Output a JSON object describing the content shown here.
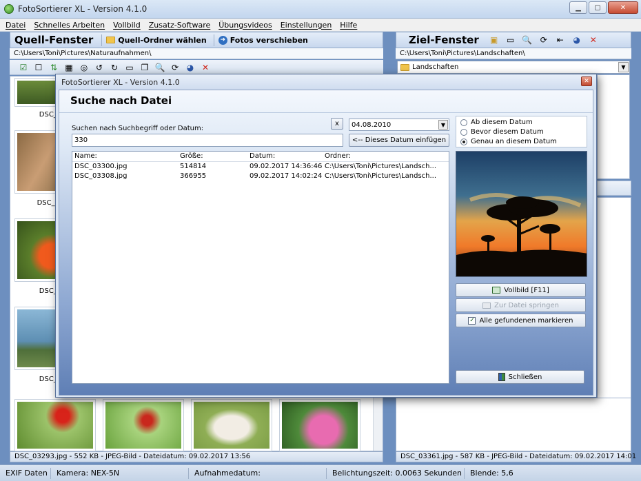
{
  "app": {
    "title": "FotoSortierer XL - Version 4.1.0",
    "accent": "#c8d8ee"
  },
  "menu": [
    "Datei",
    "Schnelles Arbeiten",
    "Vollbild",
    "Zusatz-Software",
    "Übungsvideos",
    "Einstellungen",
    "Hilfe"
  ],
  "left": {
    "title": "Quell-Fenster",
    "choose_folder": "Quell-Ordner wählen",
    "move_photos": "Fotos verschieben",
    "path": "C:\\Users\\Toni\\Pictures\\Naturaufnahmen\\",
    "thumb_labels": [
      "DSC_0",
      "DSC_03",
      "DSC_0",
      "DSC_0"
    ],
    "status": "DSC_03293.jpg - 552 KB - JPEG-Bild - Dateidatum: 09.02.2017 13:56"
  },
  "right": {
    "title": "Ziel-Fenster",
    "path": "C:\\Users\\Toni\\Pictures\\Landschaften\\",
    "folder": "Landschaften",
    "status": "DSC_03361.jpg - 587 KB - JPEG-Bild - Dateidatum: 09.02.2017 14:01"
  },
  "exif": {
    "label": "EXIF Daten",
    "camera": "Kamera: NEX-5N",
    "date": "Aufnahmedatum:",
    "exposure": "Belichtungszeit: 0.0063 Sekunden",
    "aperture": "Blende: 5,6"
  },
  "dialog": {
    "title": "FotoSortierer XL - Version 4.1.0",
    "heading": "Suche nach Datei",
    "search_label": "Suchen nach Suchbegriff oder Datum:",
    "search_value": "330",
    "clear_button": "x",
    "date_value": "04.08.2010",
    "insert_date_button": "<-- Dieses Datum einfügen",
    "radio_options": [
      "Ab diesem Datum",
      "Bevor diesem Datum",
      "Genau an diesem Datum"
    ],
    "radio_selected": 2,
    "columns": [
      "Name:",
      "Größe:",
      "Datum:",
      "Ordner:"
    ],
    "rows": [
      [
        "DSC_03300.jpg",
        "514814",
        "09.02.2017 14:36:46",
        "C:\\Users\\Toni\\Pictures\\Landsch..."
      ],
      [
        "DSC_03308.jpg",
        "366955",
        "09.02.2017 14:02:24",
        "C:\\Users\\Toni\\Pictures\\Landsch..."
      ]
    ],
    "fullscreen_button": "Vollbild [F11]",
    "jump_button": "Zur Datei springen",
    "mark_all_button": "Alle gefundenen markieren",
    "close_button": "Schließen"
  }
}
